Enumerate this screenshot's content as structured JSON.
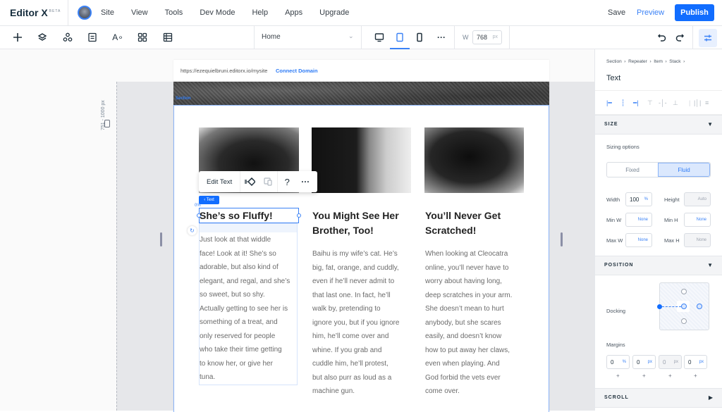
{
  "app": {
    "name": "Editor X",
    "badge": "BETA"
  },
  "menu": [
    "Site",
    "View",
    "Tools",
    "Dev Mode",
    "Help",
    "Apps",
    "Upgrade"
  ],
  "actions": {
    "save": "Save",
    "preview": "Preview",
    "publish": "Publish"
  },
  "toolbar": {
    "tools": [
      "add-icon",
      "layers-icon",
      "components-icon",
      "pages-icon",
      "theme-icon",
      "apps-grid-icon",
      "cms-table-icon"
    ],
    "page": "Home",
    "devices": [
      "desktop",
      "tablet",
      "mobile"
    ],
    "active_device": "tablet",
    "width_label": "W",
    "width_value": "768",
    "width_unit": "px"
  },
  "canvas": {
    "breakpoint_range": "751 - 1000 px",
    "url": "https://ezequielbruni.editorx.io/mysite",
    "connect_domain": "Connect Domain",
    "section_tag": "Section",
    "context_menu": {
      "edit_text": "Edit Text",
      "help": "?",
      "more": "···"
    },
    "selected_tag": "‹ Text",
    "percent_marker": "0%",
    "cards": [
      {
        "heading": "She’s so Fluffy!",
        "body": "Just look at that widdle face! Look at it! She’s so adorable, but also kind of elegant, and regal, and she’s so sweet, but so shy. Actually getting to see her is something of a treat, and only reserved for people who take their time getting to know her, or give her tuna.",
        "lines": [
          "Just look at that widdle",
          "face! Look at it! She’s so",
          "adorable, but also kind of",
          "elegant, and regal, and she’s",
          "so sweet, but so shy.",
          "Actually getting to see her is",
          "something of a treat, and",
          "only reserved for people",
          "who take their time getting",
          "to know her, or give her",
          "tuna."
        ]
      },
      {
        "heading": "You Might See Her Brother, Too!",
        "heading_lines": [
          "You Might See Her",
          "Brother, Too!"
        ],
        "lines": [
          "Baihu is my wife’s cat. He’s",
          "big, fat, orange, and cuddly,",
          "even if he’ll never admit to",
          "that last one. In fact, he’ll",
          "walk by, pretending to",
          "ignore you, but if you ignore",
          "him, he’ll come over and",
          "whine. If you grab and",
          "cuddle him, he’ll protest,",
          "but also purr as loud as a",
          "machine gun."
        ]
      },
      {
        "heading": "You’ll Never Get Scratched!",
        "heading_lines": [
          "You’ll Never Get",
          "Scratched!"
        ],
        "lines": [
          "When looking at Cleocatra",
          "online, you’ll never have to",
          "worry about having long,",
          "deep scratches in your arm.",
          "She doesn’t mean to hurt",
          "anybody, but she scares",
          "easily, and doesn’t know",
          "how to put away her claws,",
          "even when playing. And",
          "God forbid the vets ever",
          "come over."
        ]
      }
    ]
  },
  "panel": {
    "breadcrumb": [
      "Section",
      "Repeater",
      "Item",
      "Stack"
    ],
    "title": "Text",
    "size": {
      "header": "SIZE",
      "sizing_options": "Sizing options",
      "modes": [
        "Fixed",
        "Fluid"
      ],
      "active_mode": "Fluid",
      "width": {
        "label": "Width",
        "value": "100",
        "unit": "%"
      },
      "height": {
        "label": "Height",
        "value": "Auto"
      },
      "min_w": {
        "label": "Min W",
        "value": "None"
      },
      "min_h": {
        "label": "Min H",
        "value": "None"
      },
      "max_w": {
        "label": "Max W",
        "value": "None"
      },
      "max_h": {
        "label": "Max H",
        "value": "None"
      }
    },
    "position": {
      "header": "POSITION",
      "docking": "Docking",
      "margins_label": "Margins",
      "margins": [
        {
          "value": "0",
          "unit": "%"
        },
        {
          "value": "0",
          "unit": "px"
        },
        {
          "value": "0",
          "unit": "px",
          "disabled": true
        },
        {
          "value": "0",
          "unit": "px"
        }
      ],
      "plus": "+"
    },
    "scroll": {
      "header": "SCROLL"
    }
  },
  "colors": {
    "accent": "#116dff",
    "selection": "#3b82f6"
  }
}
